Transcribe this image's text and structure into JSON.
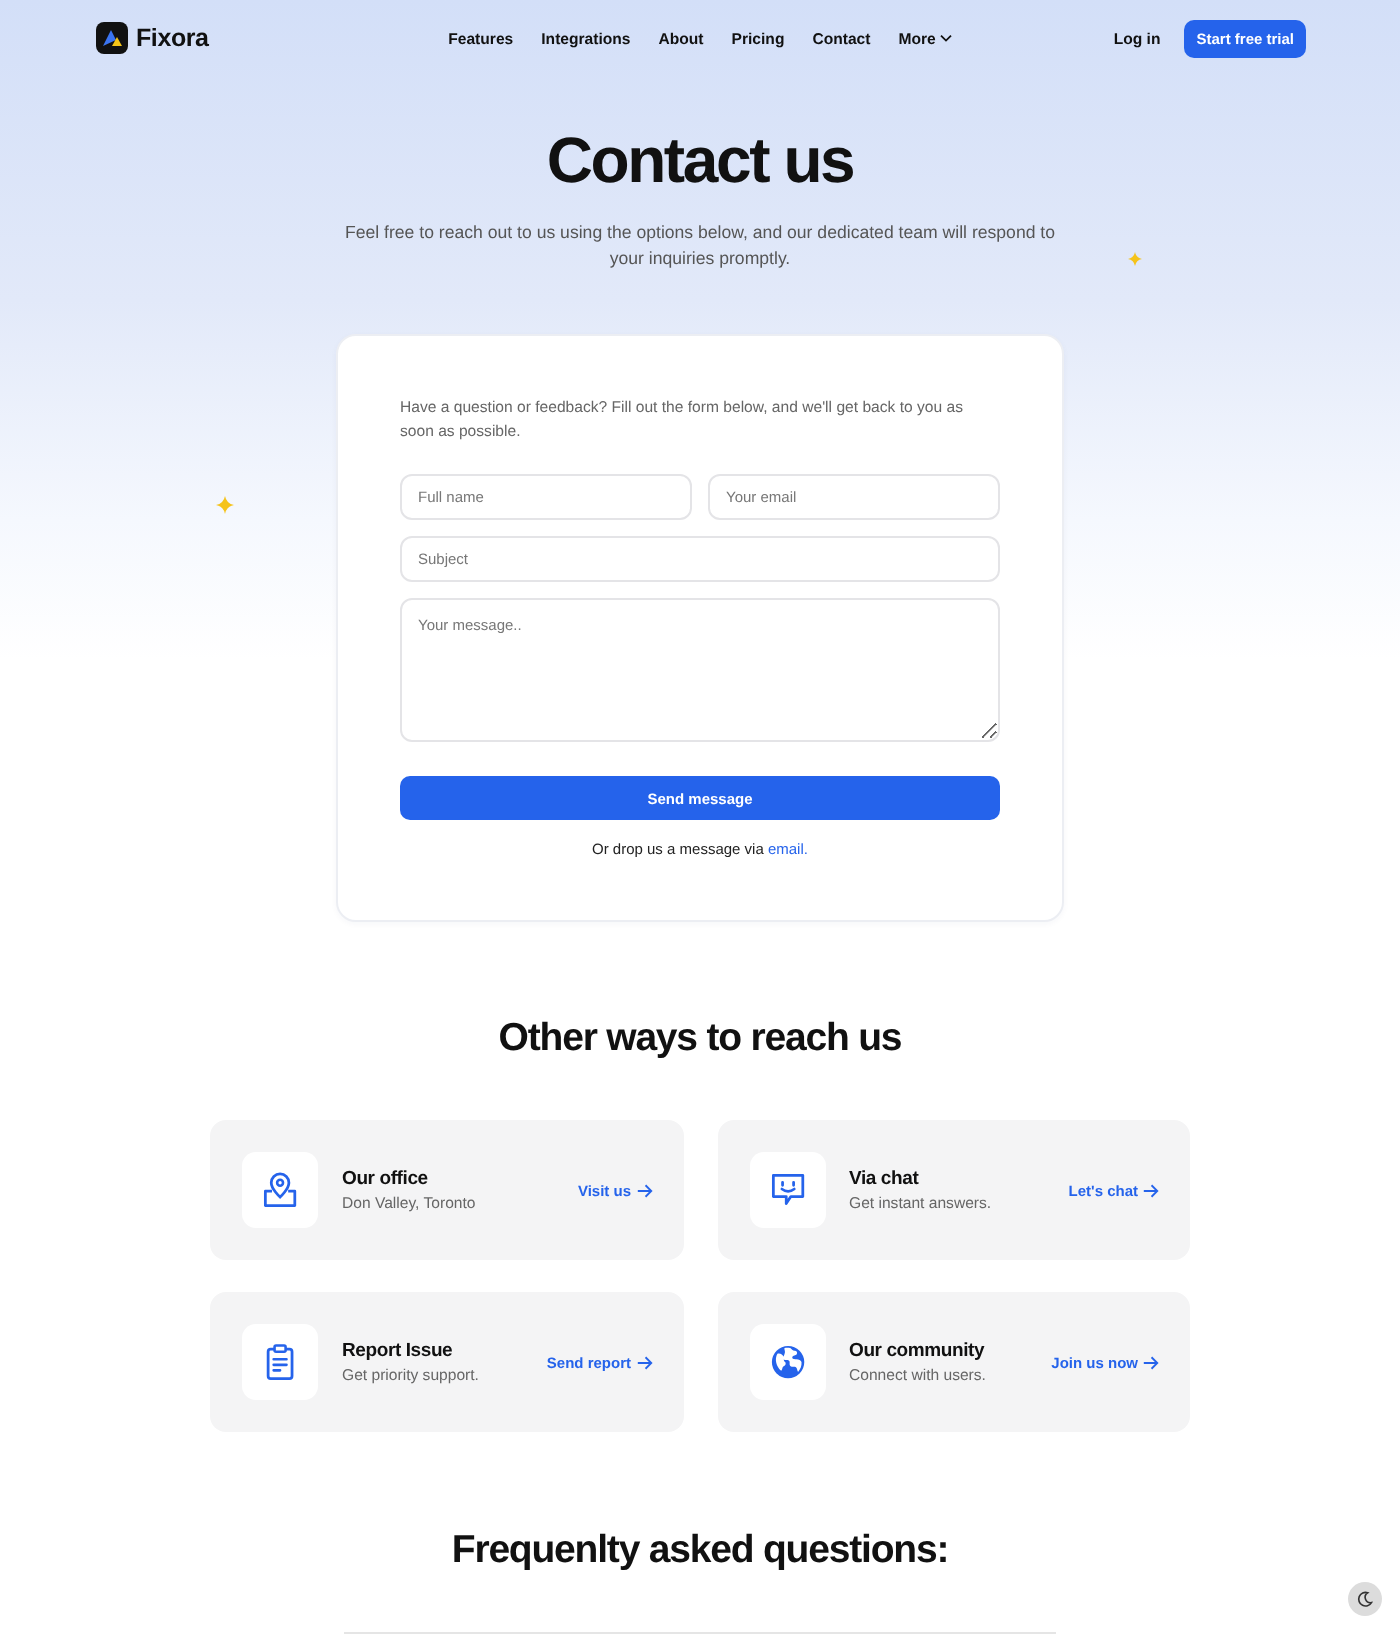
{
  "header": {
    "brand": "Fixora",
    "nav": [
      {
        "label": "Features",
        "kind": "link"
      },
      {
        "label": "Integrations",
        "kind": "link"
      },
      {
        "label": "About",
        "kind": "link"
      },
      {
        "label": "Pricing",
        "kind": "link"
      },
      {
        "label": "Contact",
        "kind": "link"
      },
      {
        "label": "More",
        "kind": "dropdown"
      }
    ],
    "login": "Log in",
    "cta": "Start free trial"
  },
  "hero": {
    "title": "Contact us",
    "subtitle": "Feel free to reach out to us using the options below, and our dedicated team will respond to your inquiries promptly."
  },
  "form": {
    "intro": "Have a question or feedback? Fill out the form below, and we'll get back to you as soon as possible.",
    "field_rows": [
      [
        {
          "kind": "input",
          "placeholder": "Full name"
        },
        {
          "kind": "input",
          "placeholder": "Your email"
        }
      ],
      [
        {
          "kind": "input",
          "placeholder": "Subject"
        }
      ],
      [
        {
          "kind": "textarea",
          "placeholder": "Your message.."
        }
      ]
    ],
    "submit": "Send message",
    "note": "Or drop us a message via",
    "note_link": "email."
  },
  "contact_options": {
    "title": "Other ways to reach us",
    "items": [
      {
        "kind": "location",
        "title": "Our office",
        "detail": "Don Valley, Toronto",
        "link": "Visit us"
      },
      {
        "kind": "chat",
        "title": "Via chat",
        "detail": "Get instant answers.",
        "link": "Let's chat"
      },
      {
        "kind": "report",
        "title": "Report Issue",
        "detail": "Get priority support.",
        "link": "Send report"
      },
      {
        "kind": "community",
        "title": "Our community",
        "detail": "Connect with users.",
        "link": "Join us now"
      }
    ]
  },
  "faq": {
    "title": "Frequenlty asked questions:"
  }
}
